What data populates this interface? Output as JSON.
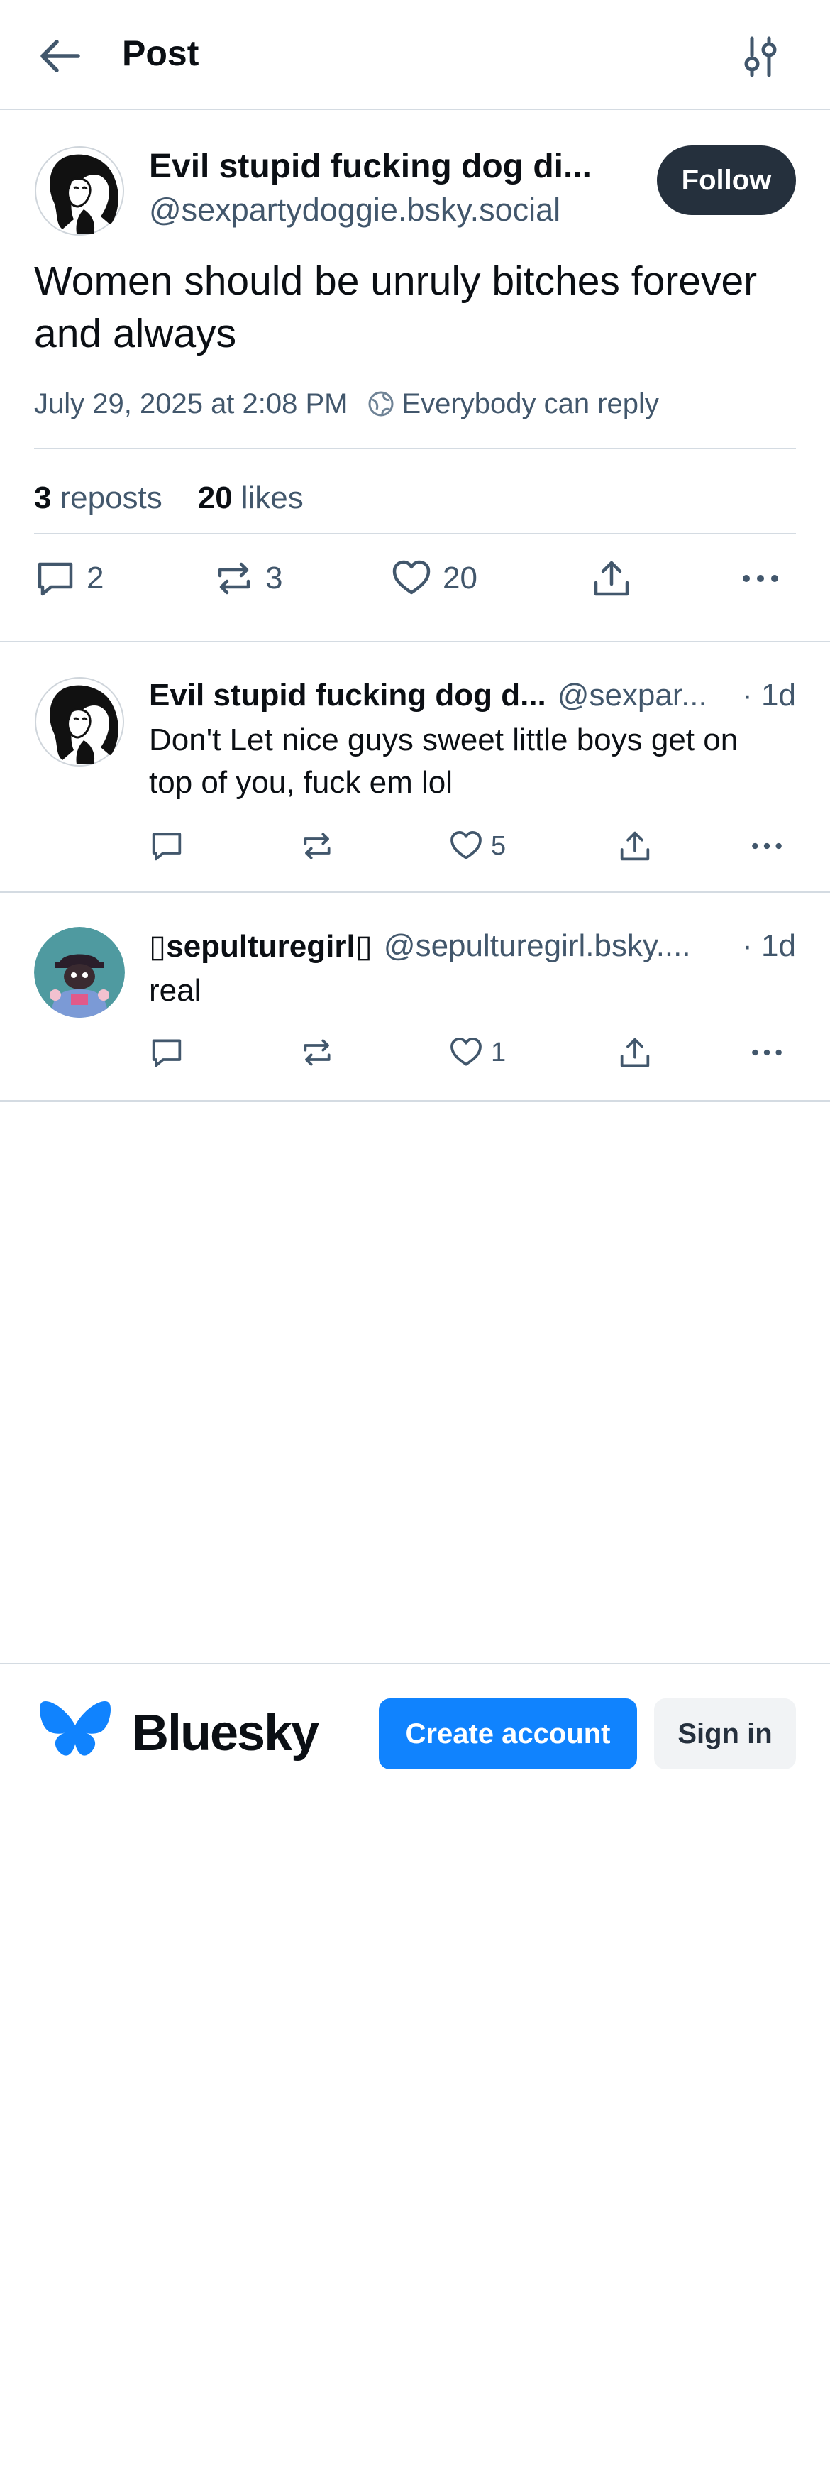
{
  "header": {
    "title": "Post",
    "back_icon": "arrow-left-icon",
    "settings_icon": "sliders-icon"
  },
  "main_post": {
    "author_name": "Evil stupid fucking dog di...",
    "author_handle": "@sexpartydoggie.bsky.social",
    "follow_label": "Follow",
    "text": "Women should be unruly bitches forever and always",
    "timestamp": "July 29, 2025 at 2:08 PM",
    "reply_setting": "Everybody can reply",
    "reposts_count": "3",
    "reposts_label": "reposts",
    "likes_count": "20",
    "likes_label": "likes",
    "actions": {
      "reply_count": "2",
      "repost_count": "3",
      "like_count": "20"
    }
  },
  "replies": [
    {
      "author_name": "Evil stupid fucking dog d...",
      "author_handle": "@sexpar...",
      "time": "· 1d",
      "text": "Don't Let nice guys sweet little boys get on top of you, fuck em lol",
      "like_count": "5"
    },
    {
      "author_name": "▯sepulturegirl▯",
      "author_handle": "@sepulturegirl.bsky....",
      "time": "· 1d",
      "text": "real",
      "like_count": "1"
    }
  ],
  "bottom_bar": {
    "brand": "Bluesky",
    "create_account_label": "Create account",
    "sign_in_label": "Sign in"
  },
  "colors": {
    "accent": "#1083fe",
    "text_primary": "#0b0f14",
    "text_secondary": "#42576c",
    "border": "#d4dbe2",
    "follow_bg": "#25303d"
  }
}
